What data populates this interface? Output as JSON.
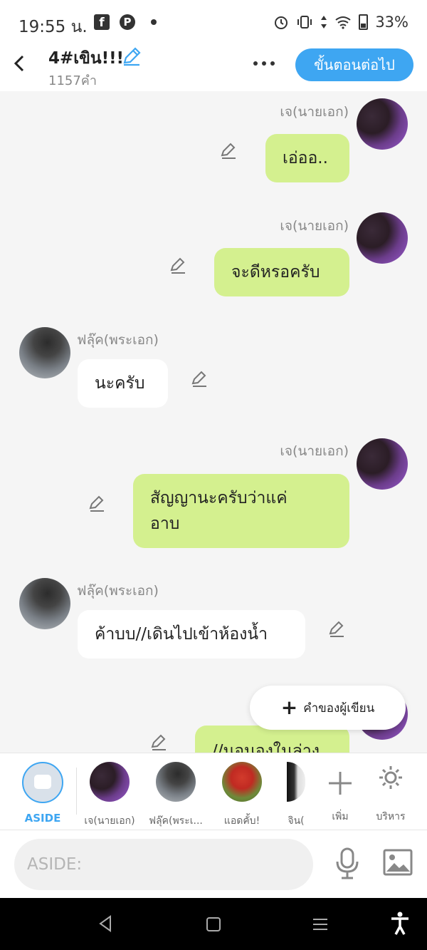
{
  "status_bar": {
    "time": "19:55 น.",
    "battery": "33%"
  },
  "header": {
    "title": "4#เขิน!!!",
    "word_count": "1157คำ",
    "next_button": "ขั้นตอนต่อไป"
  },
  "messages": [
    {
      "sender": "เจ(นายเอก)",
      "text": "เอ่ออ.."
    },
    {
      "sender": "เจ(นายเอก)",
      "text": "จะดีหรอครับ"
    },
    {
      "sender": "ฟลุ๊ค(พระเอก)",
      "text": "นะครับ"
    },
    {
      "sender": "เจ(นายเอก)",
      "text_line1": "สัญญานะครับว่าแค่",
      "text_line2": "อาบ"
    },
    {
      "sender": "ฟลุ๊ค(พระเอก)",
      "text": "ค้าบบ//เดินไปเข้าห้องน้ำ"
    },
    {
      "text": "//นอนองในล่าง"
    }
  ],
  "fab": {
    "label": "คำของผู้เขียน"
  },
  "characters": {
    "aside": "ASIDE",
    "items": [
      "เจ(นายเอก)",
      "ฟลุ๊ค(พระเ...",
      "แอดคั้บ!",
      "จิน("
    ],
    "add": "เพิ่ม",
    "manage": "บริหาร"
  },
  "input": {
    "placeholder": "ASIDE:"
  },
  "colors": {
    "accent": "#3ea6f2",
    "bubble_green": "#d4f08f"
  }
}
